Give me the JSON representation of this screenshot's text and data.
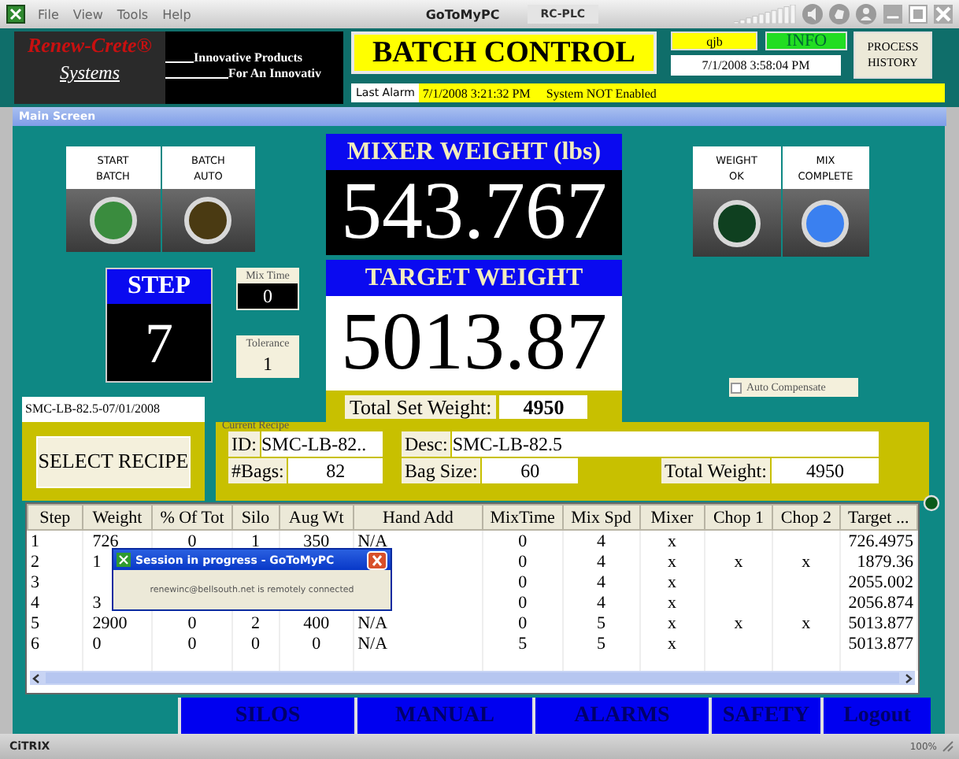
{
  "toolbar": {
    "menu": [
      "File",
      "View",
      "Tools",
      "Help"
    ],
    "brand": "GoToMyPC",
    "session_tab": "RC-PLC"
  },
  "header": {
    "logo": {
      "name": "Renew-Crete®",
      "subtitle": "Systems",
      "tagline": [
        "Innovative Products",
        "For An Innovativ"
      ]
    },
    "title": "BATCH CONTROL",
    "user": "qjb",
    "info_button": "INFO",
    "datetime": "7/1/2008  3:58:04 PM",
    "process_history_button": "PROCESS HISTORY",
    "last_alarm": {
      "label": "Last Alarm",
      "time": "7/1/2008  3:21:32 PM",
      "message": "System NOT Enabled"
    }
  },
  "screen_title": "Main Screen",
  "lights_left": [
    {
      "label": [
        "START",
        "BATCH"
      ],
      "color": "#3a8c3e"
    },
    {
      "label": [
        "BATCH",
        "AUTO"
      ],
      "color": "#4a3a12"
    }
  ],
  "lights_right": [
    {
      "label": [
        "WEIGHT",
        "OK"
      ],
      "color": "#0f4020"
    },
    {
      "label": [
        "MIX",
        "COMPLETE"
      ],
      "color": "#3a80f0"
    }
  ],
  "step": {
    "label": "STEP",
    "value": "7"
  },
  "mix_time": {
    "label": "Mix Time",
    "value": "0"
  },
  "tolerance": {
    "label": "Tolerance",
    "value": "1"
  },
  "mixer_weight": {
    "label": "MIXER WEIGHT (lbs)",
    "value": "543.767"
  },
  "target_weight": {
    "label": "TARGET WEIGHT",
    "value": "5013.87"
  },
  "total_set_weight": {
    "label": "Total Set Weight:",
    "value": "4950"
  },
  "auto_compensate": {
    "label": "Auto Compensate",
    "checked": false
  },
  "recipe_name": "SMC-LB-82.5-07/01/2008",
  "select_recipe_button": "SELECT RECIPE",
  "current_recipe": {
    "legend": "Current Recipe",
    "id": {
      "label": "ID:",
      "value": "SMC-LB-82.."
    },
    "desc": {
      "label": "Desc:",
      "value": "SMC-LB-82.5"
    },
    "bags": {
      "label": "#Bags:",
      "value": "82"
    },
    "bag_size": {
      "label": "Bag Size:",
      "value": "60"
    },
    "total_weight": {
      "label": "Total Weight:",
      "value": "4950"
    }
  },
  "table": {
    "columns": [
      "Step",
      "Weight",
      "% Of Tot",
      "Silo",
      "Aug Wt",
      "Hand Add",
      "MixTime",
      "Mix Spd",
      "Mixer",
      "Chop 1",
      "Chop 2",
      "Target ..."
    ],
    "rows": [
      {
        "cells": [
          "1",
          "726",
          "0",
          "1",
          "350",
          "N/A",
          "0",
          "4",
          "x",
          null,
          null,
          "726.4975"
        ]
      },
      {
        "cells": [
          "2",
          "1",
          null,
          null,
          null,
          null,
          "0",
          "4",
          "x",
          "x",
          "x",
          "1879.36"
        ]
      },
      {
        "cells": [
          "3",
          null,
          null,
          null,
          null,
          null,
          "0",
          "4",
          "x",
          null,
          null,
          "2055.002"
        ]
      },
      {
        "cells": [
          "4",
          "3",
          null,
          null,
          null,
          null,
          "0",
          "4",
          "x",
          null,
          null,
          "2056.874"
        ]
      },
      {
        "cells": [
          "5",
          "2900",
          "0",
          "2",
          "400",
          "N/A",
          "0",
          "5",
          "x",
          "x",
          "x",
          "5013.877"
        ]
      },
      {
        "cells": [
          "6",
          "0",
          "0",
          "0",
          "0",
          "N/A",
          "5",
          "5",
          "x",
          null,
          null,
          "5013.877"
        ]
      }
    ]
  },
  "dialog": {
    "title": "Session in progress - GoToMyPC",
    "message": "renewinc@bellsouth.net is remotely connected"
  },
  "nav": [
    "SILOS",
    "MANUAL",
    "ALARMS",
    "SAFETY",
    "Logout"
  ],
  "status_bar": {
    "brand": "CiTRIX",
    "zoom": "100%"
  }
}
